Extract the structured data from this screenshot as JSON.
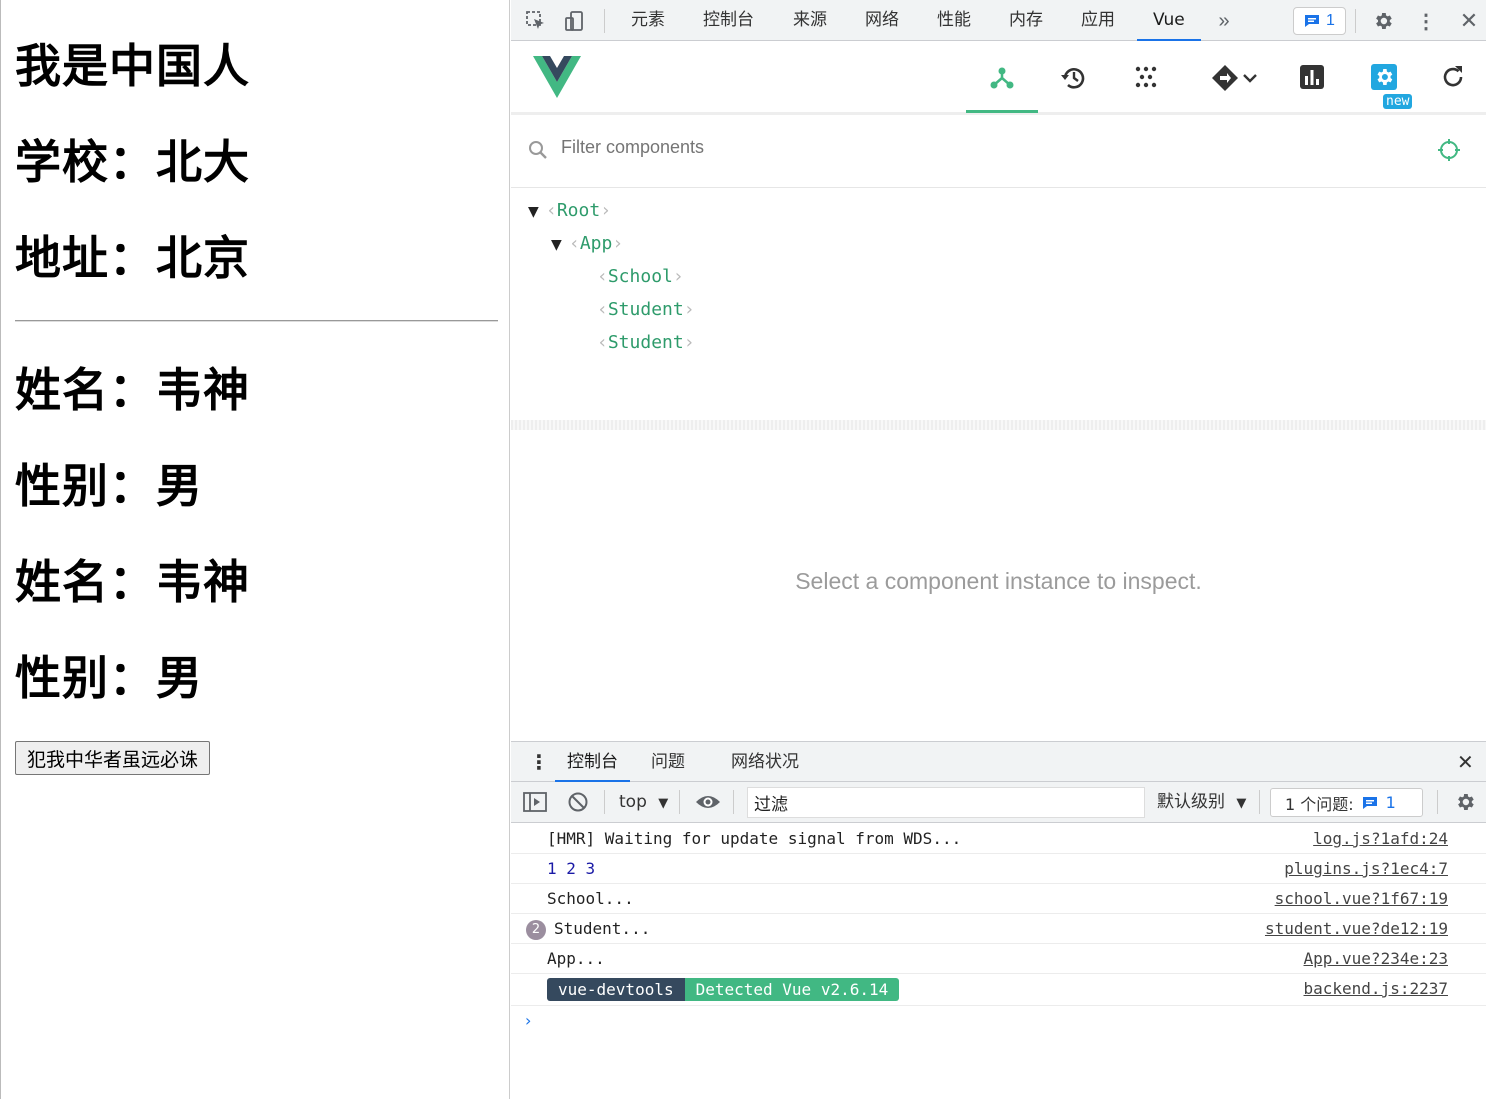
{
  "page": {
    "school_name": "我是中国人",
    "school_label": "学校：北大",
    "address_label": "地址：北京",
    "student1_name": "姓名：韦神",
    "student1_gender": "性别：男",
    "student2_name": "姓名：韦神",
    "student2_gender": "性别：男",
    "button_label": "犯我中华者虽远必诛"
  },
  "devtools": {
    "tabs": [
      "元素",
      "控制台",
      "来源",
      "网络",
      "性能",
      "内存",
      "应用",
      "Vue"
    ],
    "active_tab": "Vue",
    "issue_count": "1"
  },
  "vue": {
    "new_badge": "new",
    "filter_placeholder": "Filter components",
    "tree": [
      {
        "name": "Root",
        "expanded": true
      },
      {
        "name": "App",
        "expanded": true
      },
      {
        "name": "School"
      },
      {
        "name": "Student"
      },
      {
        "name": "Student"
      }
    ],
    "inspect_message": "Select a component instance to inspect."
  },
  "drawer": {
    "tabs": [
      "控制台",
      "问题",
      "网络状况"
    ],
    "active_tab": "控制台"
  },
  "console": {
    "context": "top",
    "filter_value": "过滤",
    "level": "默认级别",
    "issues_label": "1 个问题:",
    "issues_count": "1",
    "logs": [
      {
        "msg": "[HMR] Waiting for update signal from WDS...",
        "src": "log.js?1afd:24"
      },
      {
        "msg": "1 2 3",
        "src": "plugins.js?1ec4:7"
      },
      {
        "msg": "School...",
        "src": "school.vue?1f67:19"
      },
      {
        "msg": "Student...",
        "src": "student.vue?de12:19",
        "repeat": "2"
      },
      {
        "msg": "App...",
        "src": "App.vue?234e:23"
      },
      {
        "badge_left": "vue-devtools",
        "badge_right": "Detected Vue v2.6.14",
        "src": "backend.js:2237"
      }
    ],
    "prompt": "›"
  },
  "colors": {
    "vue_green": "#42b883",
    "vue_dark": "#35495e",
    "accent_blue": "#1a73e8"
  }
}
